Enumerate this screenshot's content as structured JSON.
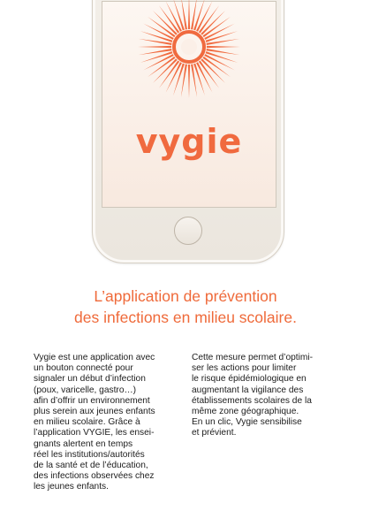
{
  "app": {
    "brand_name": "vygie",
    "logo_icon": "sunburst-logo-icon",
    "brand_color": "#f06a3f"
  },
  "headline": {
    "line1": "L’application de prévention",
    "line2": "des infections en milieu scolaire."
  },
  "body": {
    "left": "Vygie est une application avec\nun bouton connecté pour\nsignaler un début d’infection\n(poux, varicelle, gastro…)\nafin d’offrir un environnement\nplus serein aux jeunes enfants\nen milieu scolaire. Grâce à\nl’application VYGIE, les ensei-\ngnants alertent en temps\nréel les institutions/autorités\nde la santé et de l’éducation,\ndes infections observées chez\nles jeunes enfants.",
    "right": "Cette mesure permet d’optimi-\nser les actions pour limiter\nle risque épidémiologique en\naugmentant la vigilance des\nétablissements scolaires de la\nmême zone géographique.\nEn un clic, Vygie sensibilise\net prévient."
  }
}
